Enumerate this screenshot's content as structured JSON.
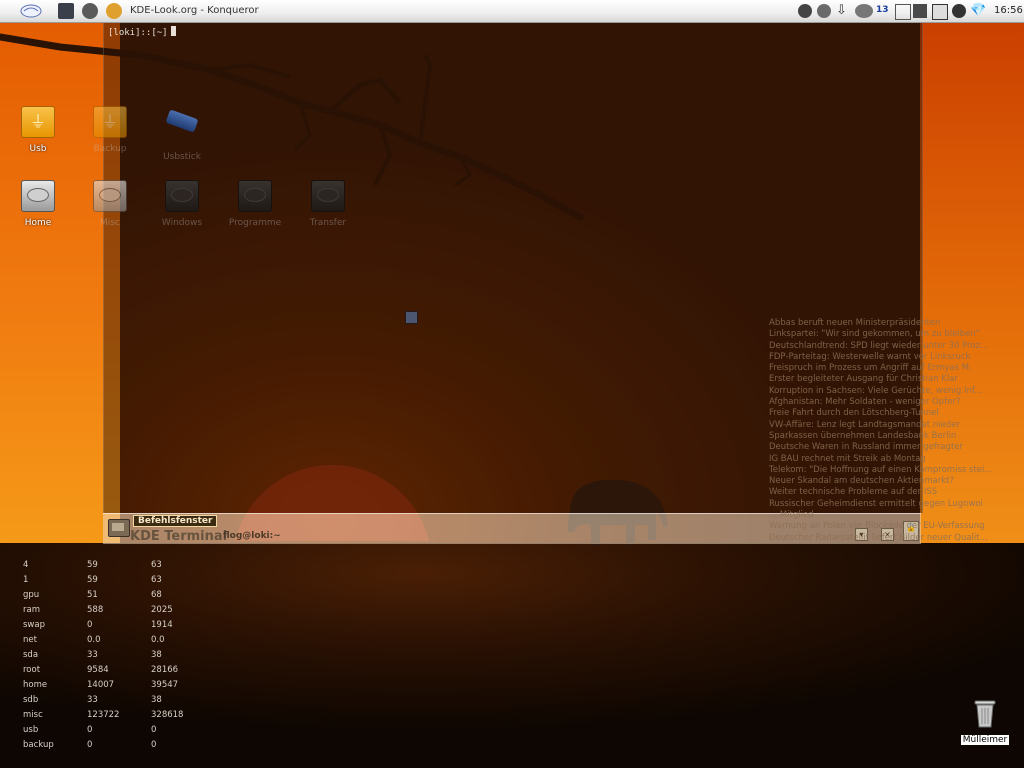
{
  "taskbar": {
    "window_title": "KDE-Look.org - Konqueror",
    "tray_badge": "13",
    "clock": "16:56"
  },
  "terminal": {
    "prompt": "[loki]::[~]",
    "bar_label": "Befehlsfenster",
    "app_name": "KDE Terminal",
    "session": "flog@loki:~"
  },
  "desktop_icons": [
    {
      "label": "Usb"
    },
    {
      "label": "Backup"
    },
    {
      "label": "Usbstick"
    },
    {
      "label": "Home"
    },
    {
      "label": "Misc"
    },
    {
      "label": "Windows"
    },
    {
      "label": "Programme"
    },
    {
      "label": "Transfer"
    }
  ],
  "news": [
    "Abbas beruft neuen Ministerpräsidenten",
    "Linkspartei: \"Wir sind gekommen, um zu bleiben\"",
    "Deutschlandtrend: SPD liegt wieder unter 30 Proz...",
    "FDP-Parteitag: Westerwelle warnt vor Linksruck",
    "Freispruch im Prozess um Angriff auf Ermyas M.",
    "Erster begleiteter Ausgang für Christian Klar",
    "Korruption in Sachsen: Viele Gerüchte, wenig Inf...",
    "Afghanistan: Mehr Soldaten - weniger Opfer?",
    "Freie Fahrt durch den Lötschberg-Tunnel",
    "VW-Affäre: Lenz legt Landtagsmandat nieder",
    "Sparkassen übernehmen Landesbank Berlin",
    "Deutsche Waren in Russland immer gefragter",
    "IG BAU rechnet mit Streik ab Montag",
    "Telekom: \"Die Hoffnung auf einen Kompromiss stei...",
    "Neuer Skandal am deutschen Aktienmarkt?",
    "Weiter technische Probleme auf der ISS",
    "Russischer Geheimdienst ermittelt gegen Lugowoi",
    "... Mitglied",
    "Warnung an Polen vor Blockade der EU-Verfassung",
    "Deutscher Radarsatellit liefert Bilder neuer Qualit..."
  ],
  "stats": [
    {
      "name": "4",
      "a": "59",
      "b": "63"
    },
    {
      "name": "1",
      "a": "59",
      "b": "63"
    },
    {
      "name": "gpu",
      "a": "51",
      "b": "68"
    },
    {
      "name": "ram",
      "a": "588",
      "b": "2025"
    },
    {
      "name": "swap",
      "a": "0",
      "b": "1914"
    },
    {
      "name": "net",
      "a": "0.0",
      "b": "0.0"
    },
    {
      "name": "sda",
      "a": "33",
      "b": "38"
    },
    {
      "name": "root",
      "a": "9584",
      "b": "28166"
    },
    {
      "name": "home",
      "a": "14007",
      "b": "39547"
    },
    {
      "name": "sdb",
      "a": "33",
      "b": "38"
    },
    {
      "name": "misc",
      "a": "123722",
      "b": "328618"
    },
    {
      "name": "usb",
      "a": "0",
      "b": "0"
    },
    {
      "name": "backup",
      "a": "0",
      "b": "0"
    }
  ],
  "trash": {
    "label": "Mülleimer"
  }
}
